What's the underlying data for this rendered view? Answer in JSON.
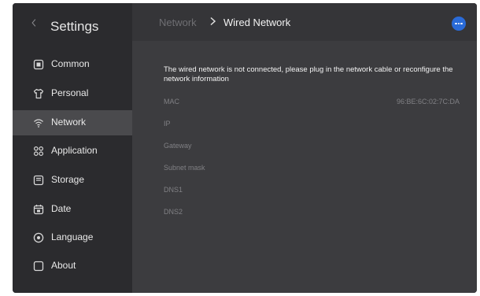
{
  "sidebar": {
    "title": "Settings",
    "items": [
      {
        "label": "Common",
        "icon": "common-icon"
      },
      {
        "label": "Personal",
        "icon": "shirt-icon"
      },
      {
        "label": "Network",
        "icon": "wifi-icon",
        "active": true
      },
      {
        "label": "Application",
        "icon": "apps-grid-icon"
      },
      {
        "label": "Storage",
        "icon": "storage-icon"
      },
      {
        "label": "Date",
        "icon": "calendar-icon"
      },
      {
        "label": "Language",
        "icon": "globe-icon"
      },
      {
        "label": "About",
        "icon": "info-square-icon"
      }
    ]
  },
  "header": {
    "breadcrumb_parent": "Network",
    "breadcrumb_current": "Wired Network",
    "more_icon": "more-dots-icon"
  },
  "content": {
    "notice": "The wired network is not connected, please plug in the network cable or reconfigure the network information",
    "rows": [
      {
        "label": "MAC",
        "value": "96:BE:6C:02:7C:DA"
      },
      {
        "label": "IP",
        "value": ""
      },
      {
        "label": "Gateway",
        "value": ""
      },
      {
        "label": "Subnet mask",
        "value": ""
      },
      {
        "label": "DNS1",
        "value": ""
      },
      {
        "label": "DNS2",
        "value": ""
      }
    ]
  },
  "colors": {
    "accent": "#2a6bd8",
    "sidebar_bg": "#2b2b2e",
    "main_bg": "#3c3c3f",
    "active_item_bg": "#4a4a4d"
  }
}
